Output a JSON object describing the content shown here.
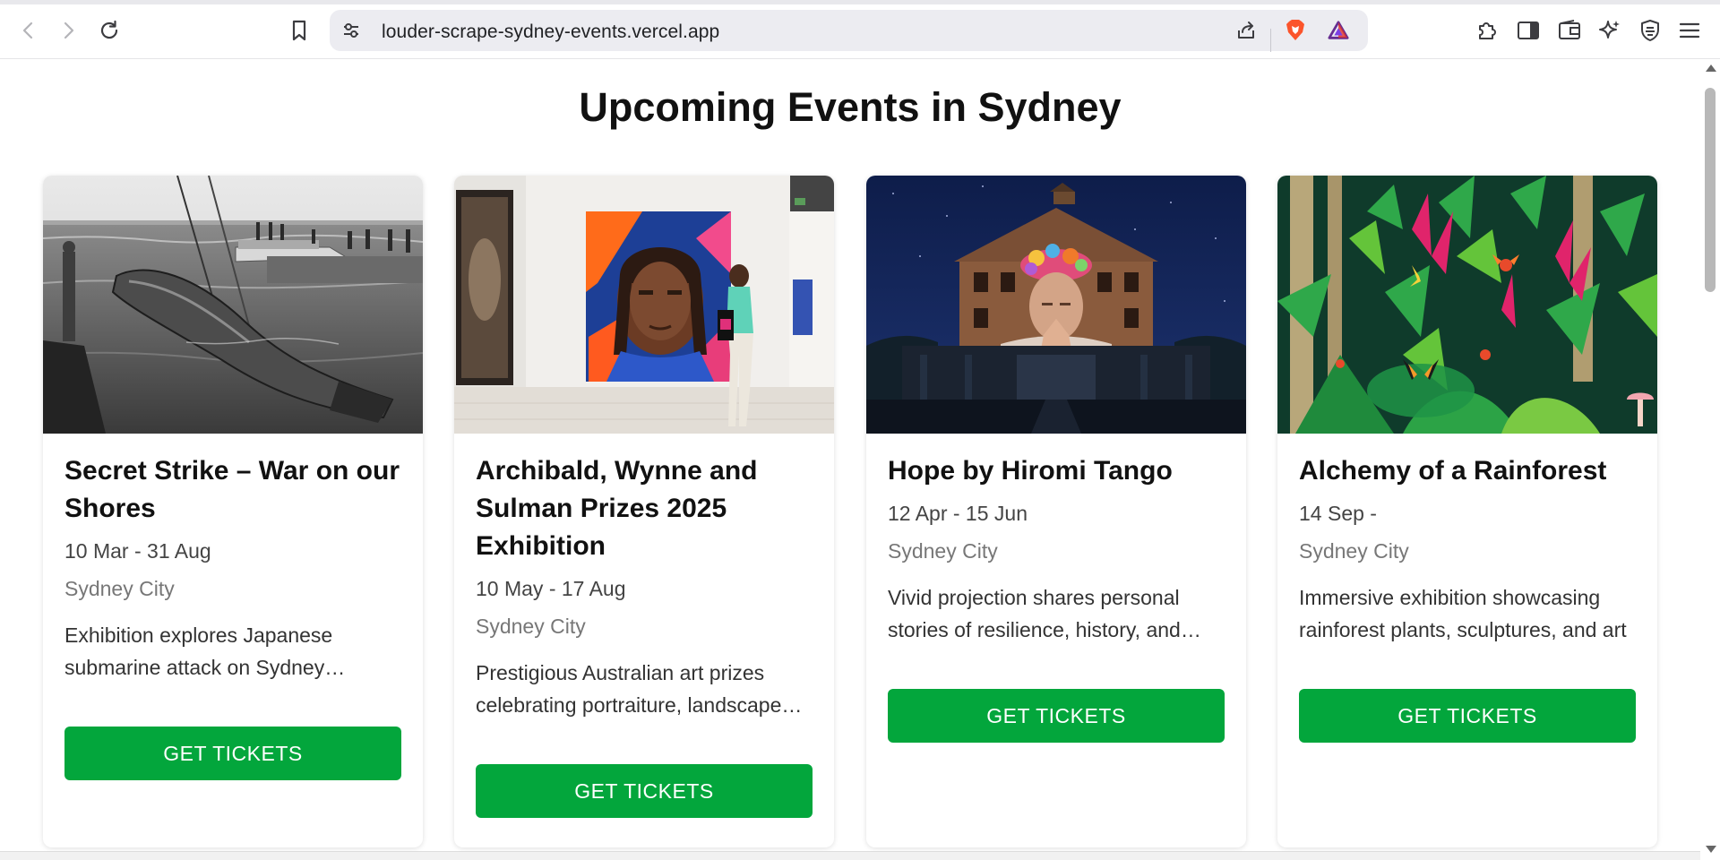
{
  "browser": {
    "url": "louder-scrape-sydney-events.vercel.app",
    "icons": [
      "back-icon",
      "forward-icon",
      "reload-icon",
      "bookmark-icon",
      "site-settings-icon",
      "share-icon",
      "brave-shields-icon",
      "brave-rewards-icon",
      "extensions-icon",
      "sidebar-icon",
      "wallet-icon",
      "leo-ai-icon",
      "vpn-icon",
      "menu-icon"
    ]
  },
  "page": {
    "title": "Upcoming Events in Sydney"
  },
  "events": [
    {
      "title": "Secret Strike – War on our Shores",
      "date": "10 Mar - 31 Aug",
      "location": "Sydney City",
      "description": "Exhibition explores Japanese submarine attack on Sydney Harbour during World War II",
      "button": "GET TICKETS",
      "image": "submarine-photo"
    },
    {
      "title": "Archibald, Wynne and Sulman Prizes 2025 Exhibition",
      "date": "10 May - 17 Aug",
      "location": "Sydney City",
      "description": "Prestigious Australian art prizes celebrating portraiture, landscape and more",
      "button": "GET TICKETS",
      "image": "gallery-portrait-photo"
    },
    {
      "title": "Hope by Hiromi Tango",
      "date": "12 Apr - 15 Jun",
      "location": "Sydney City",
      "description": "Vivid projection shares personal stories of resilience, history, and hope",
      "button": "GET TICKETS",
      "image": "building-projection-photo"
    },
    {
      "title": "Alchemy of a Rainforest",
      "date": "14 Sep -",
      "location": "Sydney City",
      "description": "Immersive exhibition showcasing rainforest plants, sculptures, and art",
      "button": "GET TICKETS",
      "image": "rainforest-illustration"
    }
  ],
  "colors": {
    "button": "#03a63c",
    "title": "#111111",
    "location": "#777777"
  }
}
